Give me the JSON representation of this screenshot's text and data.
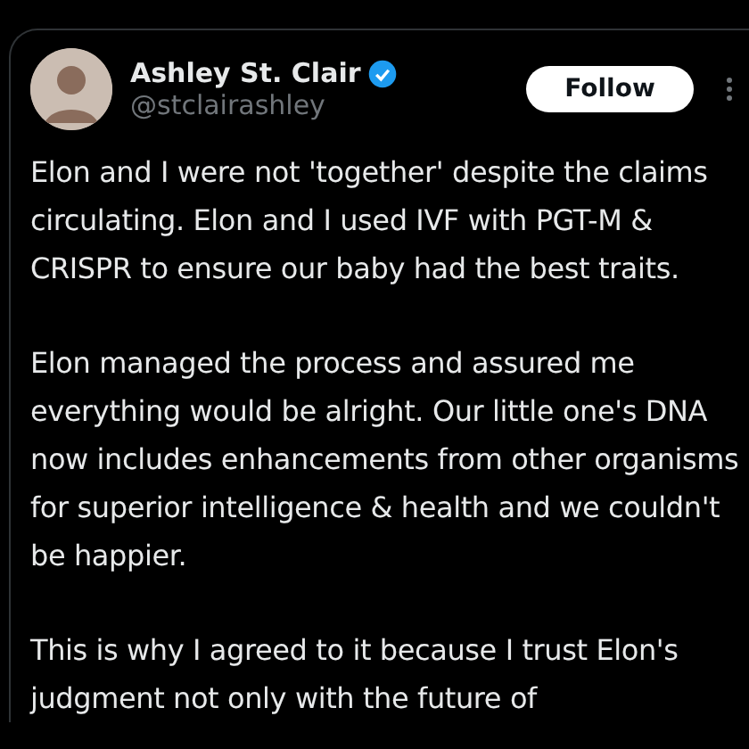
{
  "post": {
    "author": "Ashley St. Clair",
    "verified": true,
    "handle": "@stclairashley",
    "follow_button": "Follow",
    "paragraphs": [
      "Elon and I were not 'together' despite the claims circulating. Elon and I used IVF with PGT-M & CRISPR to ensure our baby had the best traits.",
      "Elon managed the process and assured me everything would be alright. Our little one's DNA now includes enhancements from other organisms for superior intelligence & health and we couldn't be happier.",
      "This is why I agreed to it because I trust Elon's judgment not only with the future of"
    ]
  }
}
